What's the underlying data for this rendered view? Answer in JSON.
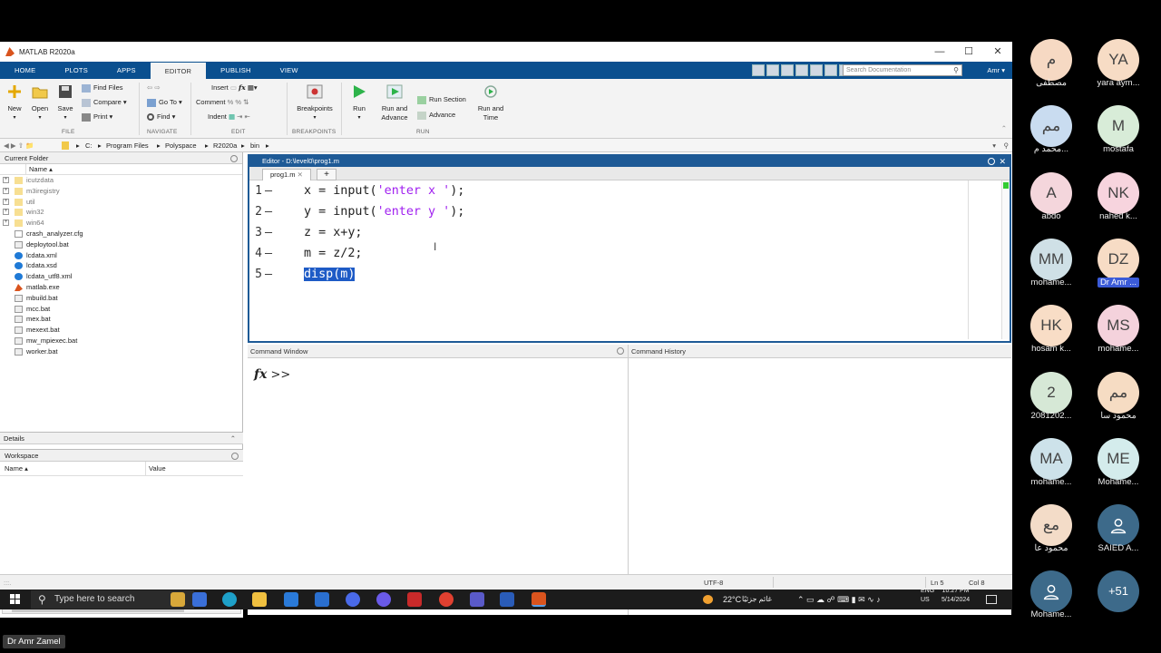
{
  "window": {
    "title": "MATLAB R2020a"
  },
  "tabs": [
    "HOME",
    "PLOTS",
    "APPS",
    "EDITOR",
    "PUBLISH",
    "VIEW"
  ],
  "active_tab": "EDITOR",
  "search": {
    "placeholder": "Search Documentation"
  },
  "user": {
    "label": "Amr ▾"
  },
  "ribbon": {
    "new": "New",
    "open": "Open",
    "save": "Save",
    "find_files": "Find Files",
    "compare": "Compare ▾",
    "print": "Print ▾",
    "go_to": "Go To ▾",
    "find": "Find ▾",
    "insert": "Insert",
    "comment": "Comment",
    "indent": "Indent",
    "breakpoints": "Breakpoints",
    "run": "Run",
    "run_advance": "Run and Advance",
    "run_section": "Run Section",
    "advance": "Advance",
    "run_time": "Run and Time",
    "groups": {
      "file": "FILE",
      "navigate": "NAVIGATE",
      "edit": "EDIT",
      "breakpoints": "BREAKPOINTS",
      "run": "RUN"
    }
  },
  "address": [
    "C:",
    "Program Files",
    "Polyspace",
    "R2020a",
    "bin"
  ],
  "current_folder": {
    "title": "Current Folder",
    "col_name": "Name ▴",
    "folders": [
      "icutzdata",
      "m3iregistry",
      "util",
      "win32",
      "win64"
    ],
    "files": [
      "crash_analyzer.cfg",
      "deploytool.bat",
      "lcdata.xml",
      "lcdata.xsd",
      "lcdata_utf8.xml",
      "matlab.exe",
      "mbuild.bat",
      "mcc.bat",
      "mex.bat",
      "mexext.bat",
      "mw_mpiexec.bat",
      "worker.bat"
    ]
  },
  "details": {
    "title": "Details"
  },
  "workspace": {
    "title": "Workspace",
    "col_name": "Name ▴",
    "col_value": "Value"
  },
  "editor": {
    "title": "Editor - D:\\level0\\prog1.m",
    "file_tab": "prog1.m",
    "lines": [
      {
        "n": "1",
        "pre": "x = input(",
        "str": "'enter x '",
        "post": ");"
      },
      {
        "n": "2",
        "pre": "y = input(",
        "str": "'enter y '",
        "post": ");"
      },
      {
        "n": "3",
        "pre": "z = x+y;",
        "str": "",
        "post": ""
      },
      {
        "n": "4",
        "pre": "m = z/2;",
        "str": "",
        "post": ""
      },
      {
        "n": "5",
        "pre": "",
        "str": "",
        "post": "",
        "selected": "disp(m)"
      }
    ]
  },
  "command_window": {
    "title": "Command Window",
    "prompt": ">>"
  },
  "command_history": {
    "title": "Command History"
  },
  "status": {
    "encoding": "UTF-8",
    "ln": "Ln  5",
    "col": "Col  8"
  },
  "taskbar": {
    "search": "Type here to search",
    "weather": "22°C",
    "weather_text": "غائم جزئيًا",
    "lang1": "ENG",
    "lang2": "US",
    "time": "10:27 PM",
    "date": "5/14/2024"
  },
  "speaker": "Dr Amr Zamel",
  "participants": [
    {
      "initials": "م",
      "name": "مصطفى",
      "color": "#f6d9c3"
    },
    {
      "initials": "YA",
      "name": "yara aym...",
      "color": "#f7dcc5"
    },
    {
      "initials": "مم",
      "name": "محمد م...",
      "color": "#c9dcf0"
    },
    {
      "initials": "M",
      "name": "mostafa",
      "color": "#d8ecd8"
    },
    {
      "initials": "A",
      "name": "abdo",
      "color": "#f4d6dc"
    },
    {
      "initials": "NK",
      "name": "nahed k...",
      "color": "#f7d4de"
    },
    {
      "initials": "MM",
      "name": "mohame...",
      "color": "#cfe0e6"
    },
    {
      "initials": "DZ",
      "name": "Dr Amr ...",
      "color": "#f7dcc5"
    },
    {
      "initials": "HK",
      "name": "hosam k...",
      "color": "#f8ddc6"
    },
    {
      "initials": "MS",
      "name": "mohame...",
      "color": "#f4d2dc"
    },
    {
      "initials": "2",
      "name": "2081202...",
      "color": "#d6e8d6"
    },
    {
      "initials": "مم",
      "name": "محمود سا",
      "color": "#f6dcc3"
    },
    {
      "initials": "MA",
      "name": "mohame...",
      "color": "#cde2ea"
    },
    {
      "initials": "ME",
      "name": "Mohame...",
      "color": "#d4ecec"
    },
    {
      "initials": "مع",
      "name": "محمود عا",
      "color": "#f3dcc8"
    },
    {
      "initials": "",
      "name": "SAIED A...",
      "color": "#3d6a8a"
    },
    {
      "initials": "",
      "name": "Mohame...",
      "color": "#3d6a8a"
    },
    {
      "initials": "+51",
      "name": "",
      "color": "#3d6a8a"
    }
  ]
}
